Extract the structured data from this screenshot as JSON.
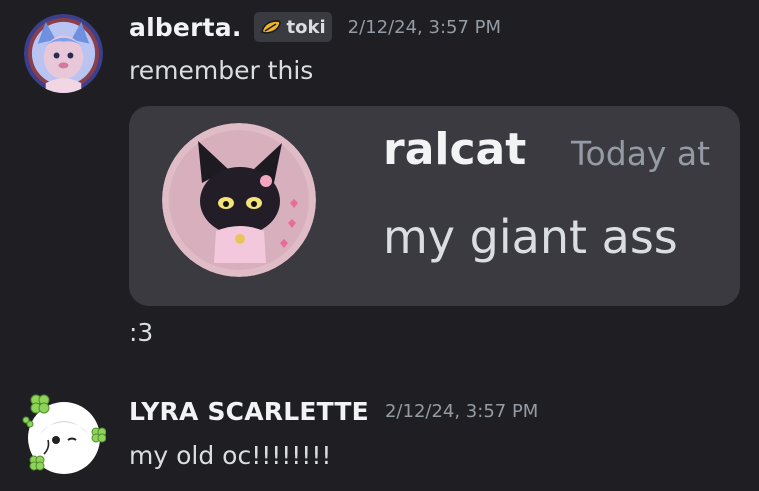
{
  "messages": [
    {
      "username": "alberta.",
      "tag": {
        "label": "toki",
        "icon": "leaf-badge-icon"
      },
      "timestamp": "2/12/24, 3:57 PM",
      "text": "remember this",
      "embed": {
        "username": "ralcat",
        "timestamp": "Today at",
        "text": "my giant ass"
      },
      "followup": ":3"
    },
    {
      "username": "LYRA SCARLETTE",
      "timestamp": "2/12/24, 3:57 PM",
      "text": "my old oc!!!!!!!!"
    }
  ],
  "colors": {
    "background": "#1f1f23",
    "embed_background": "#3a3a40",
    "username": "#f2f3f5",
    "text": "#dbdee1",
    "muted": "#949ba4"
  }
}
